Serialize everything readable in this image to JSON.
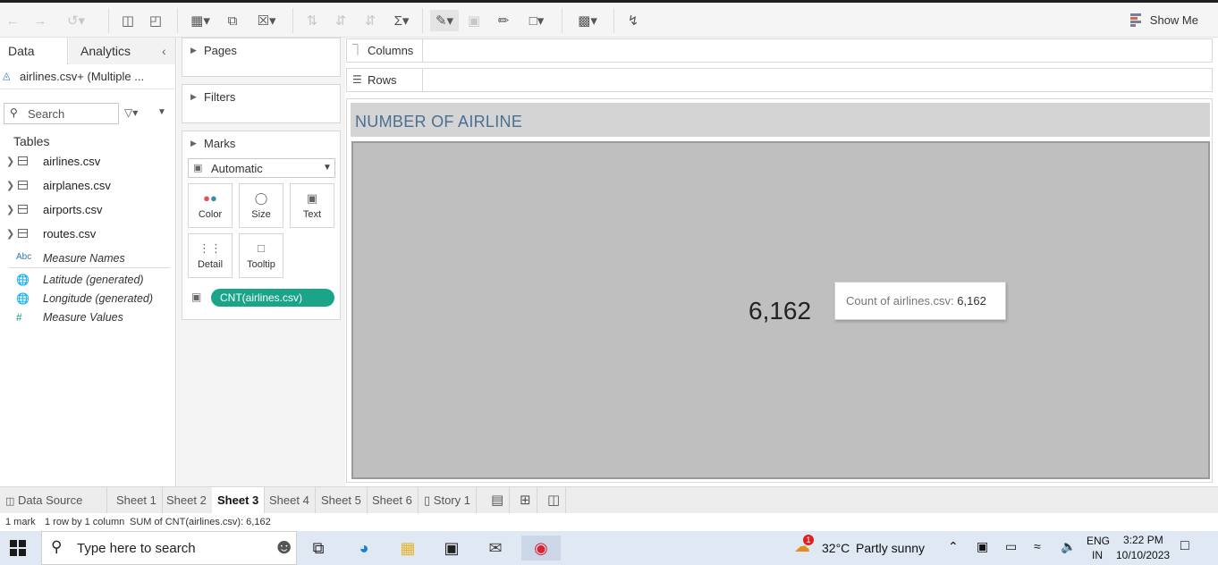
{
  "toolbar": {
    "show_me_label": "Show Me"
  },
  "data_pane": {
    "tabs": [
      "Data",
      "Analytics"
    ],
    "datasource": "airlines.csv+ (Multiple ...",
    "search_placeholder": "Search",
    "tables_label": "Tables",
    "tables": [
      "airlines.csv",
      "airplanes.csv",
      "airports.csv",
      "routes.csv"
    ],
    "fields": [
      {
        "icon": "Abc",
        "label": "Measure Names"
      },
      {
        "icon": "globe",
        "label": "Latitude (generated)"
      },
      {
        "icon": "globe",
        "label": "Longitude (generated)"
      },
      {
        "icon": "#",
        "label": "Measure Values"
      }
    ]
  },
  "cards": {
    "pages": "Pages",
    "filters": "Filters",
    "marks": "Marks",
    "mark_type": "Automatic",
    "mark_buttons": [
      "Color",
      "Size",
      "Text",
      "Detail",
      "Tooltip"
    ],
    "pill": "CNT(airlines.csv)"
  },
  "shelves": {
    "columns": "Columns",
    "rows": "Rows"
  },
  "view": {
    "title": "NUMBER OF AIRLINE",
    "value": "6,162",
    "tooltip_label": "Count of airlines.csv:",
    "tooltip_value": "6,162"
  },
  "sheet_tabs": [
    "Data Source",
    "Sheet 1",
    "Sheet 2",
    "Sheet 3",
    "Sheet 4",
    "Sheet 5",
    "Sheet 6",
    "Story 1"
  ],
  "active_sheet": "Sheet 3",
  "status": {
    "marks": "1 mark",
    "dims": "1 row by 1 column",
    "sum": "SUM of CNT(airlines.csv): 6,162"
  },
  "taskbar": {
    "search_text": "Type here to search",
    "weather_temp": "32°C",
    "weather_desc": "Partly sunny",
    "weather_badge": "1",
    "lang": "ENG",
    "region": "IN",
    "time": "3:22 PM",
    "date": "10/10/2023"
  },
  "colors": {
    "pill": "#1aa58a",
    "title_text": "#4a6f93",
    "view_bg": "#bfbfbf"
  }
}
